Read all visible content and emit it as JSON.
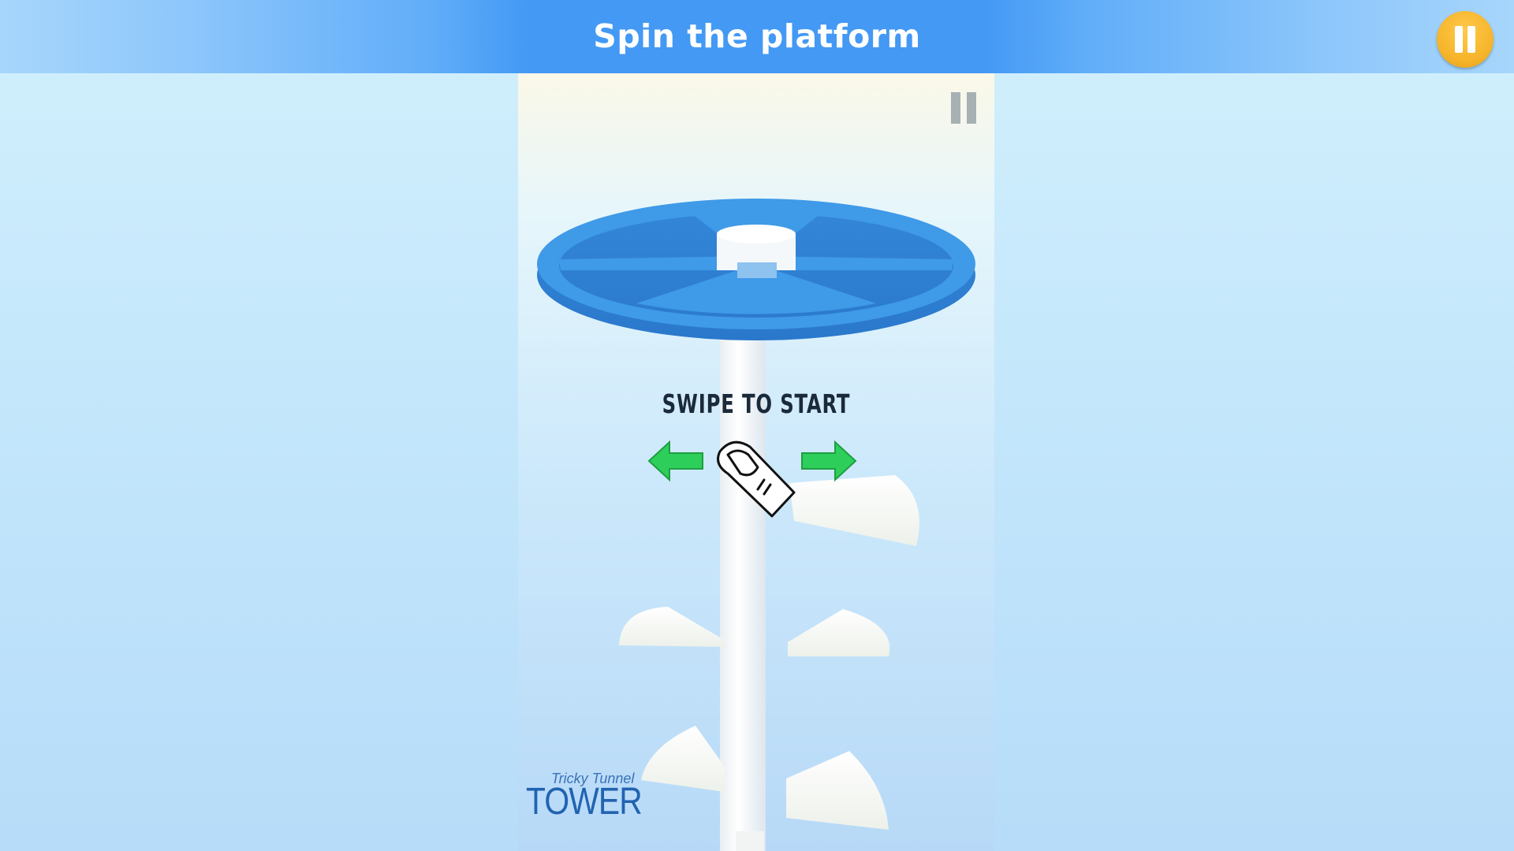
{
  "banner": {
    "title": "Spin the platform"
  },
  "game": {
    "instruction": "SWIPE TO START",
    "logo": {
      "tagline": "Tricky Tunnel",
      "title": "TOWER"
    }
  },
  "colors": {
    "banner_center": "#4399f4",
    "pause_button": "#f5b42a",
    "platform": "#3f9ae8",
    "arrow": "#2dcf5a",
    "logo": "#2163b1"
  },
  "icons": {
    "outer_pause": "pause-icon",
    "inner_pause": "pause-icon",
    "left_arrow": "arrow-left-icon",
    "right_arrow": "arrow-right-icon",
    "finger": "finger-swipe-icon"
  }
}
